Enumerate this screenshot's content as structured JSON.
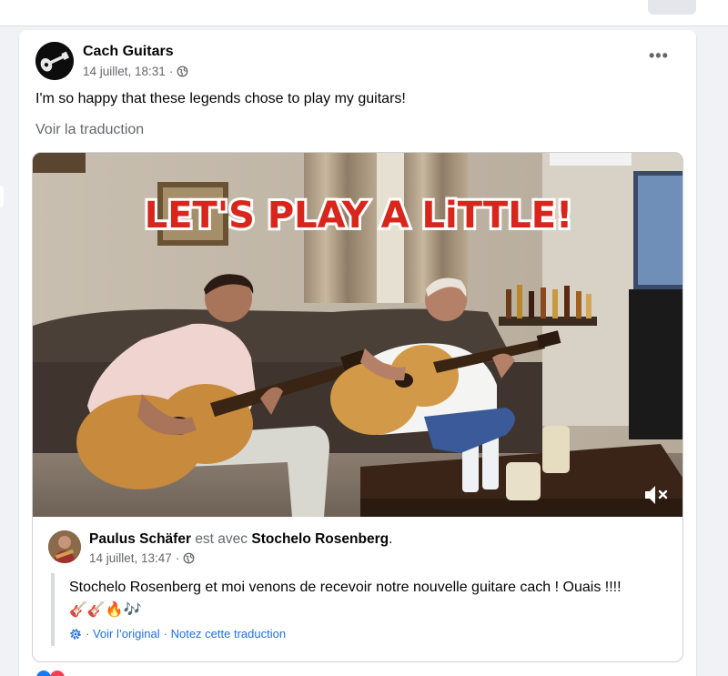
{
  "post": {
    "author": "Cach Guitars",
    "date": "14 juillet, 18:31",
    "separator": "·",
    "text": "I'm so happy that these legends chose to play my guitars!",
    "translate_link": "Voir la traduction",
    "more_label": "•••"
  },
  "video": {
    "overlay_text": "LET'S PLAY A LiTTLE!"
  },
  "shared_post": {
    "author": "Paulus Schäfer",
    "with_text": "est avec",
    "tagged": "Stochelo Rosenberg",
    "period": ".",
    "date": "14 juillet, 13:47",
    "separator": "·",
    "text": "Stochelo Rosenberg et moi venons de recevoir notre nouvelle guitare cach ! Ouais !!!!",
    "emojis": "🎸🎸🔥🎶",
    "see_original": "· Voir l’original",
    "rate_translation": "· Notez cette traduction"
  },
  "colors": {
    "link": "#216fdb",
    "secondary_text": "#65676b",
    "title_red": "#d8261c"
  }
}
